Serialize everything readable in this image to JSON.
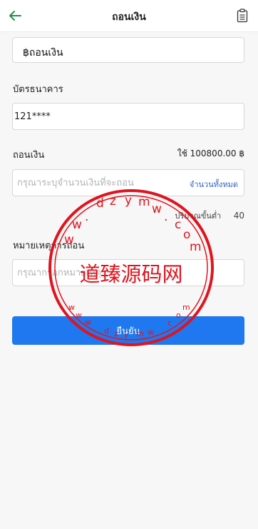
{
  "header": {
    "title": "ถอนเงิน"
  },
  "currency": {
    "label": "฿ถอนเงิน"
  },
  "bank_card": {
    "label": "บัตรธนาคาร",
    "value": "121****"
  },
  "withdraw": {
    "label": "ถอนเงิน",
    "available": "ใช้ 100800.00 ฿",
    "amount_placeholder": "กรุณาระบุจำนวนเงินที่จะถอน",
    "all_label": "จำนวนทั้งหมด",
    "min_label": "ปริมาณขั้นต่ำ",
    "min_value": "40"
  },
  "note": {
    "label": "หมายเหตุการถอน",
    "placeholder": "กรุณากรอกหมายเหตุ"
  },
  "confirm": {
    "label": "ยืนยัน"
  },
  "watermark": {
    "brand": "道臻源码网",
    "url": "dzym.com",
    "colors": {
      "stamp": "#e0141e"
    }
  },
  "colors": {
    "accent": "#1f78f0",
    "back_icon": "#1f8f4f",
    "link": "#2f5fbf"
  }
}
